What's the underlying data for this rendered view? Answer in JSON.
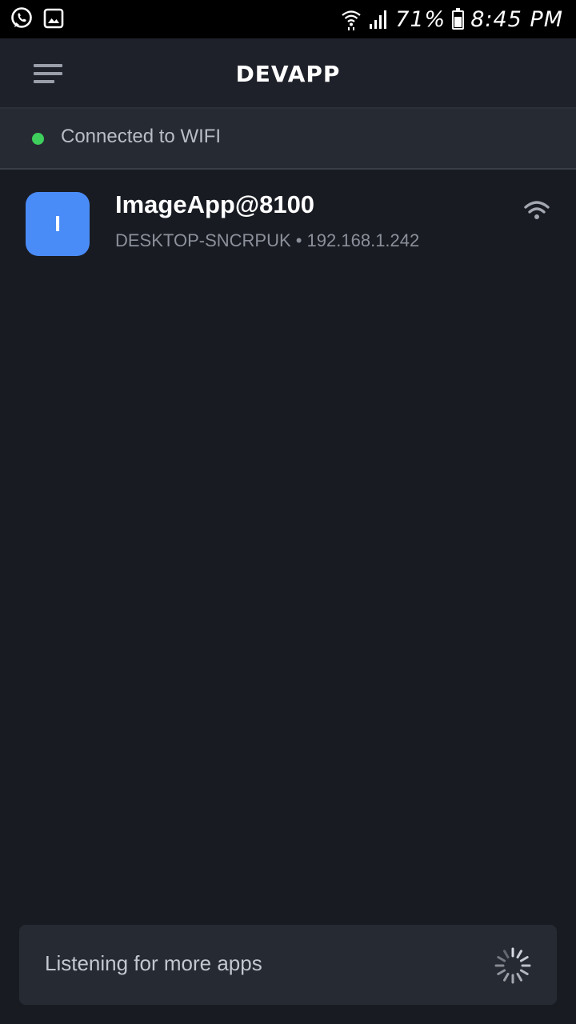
{
  "status_bar": {
    "left_icons": [
      "whatsapp-icon",
      "gallery-icon"
    ],
    "right_icons": [
      "wifi-icon",
      "signal-icon",
      "battery-icon"
    ],
    "battery": "71%",
    "battery_level": 0.71,
    "time": "8:45 PM"
  },
  "header": {
    "menu_icon": "hamburger-menu-icon",
    "title": "DEVAPP"
  },
  "connection": {
    "status_text": "Connected to WIFI",
    "indicator_color": "#3ecf5c"
  },
  "apps": [
    {
      "initial": "I",
      "name": "ImageApp@8100",
      "subtitle": "DESKTOP-SNCRPUK • 192.168.1.242",
      "avatar_color": "#4a8cf7",
      "icon": "wifi-icon"
    }
  ],
  "listening": {
    "text": "Listening for more apps",
    "icon": "spinner-icon"
  }
}
